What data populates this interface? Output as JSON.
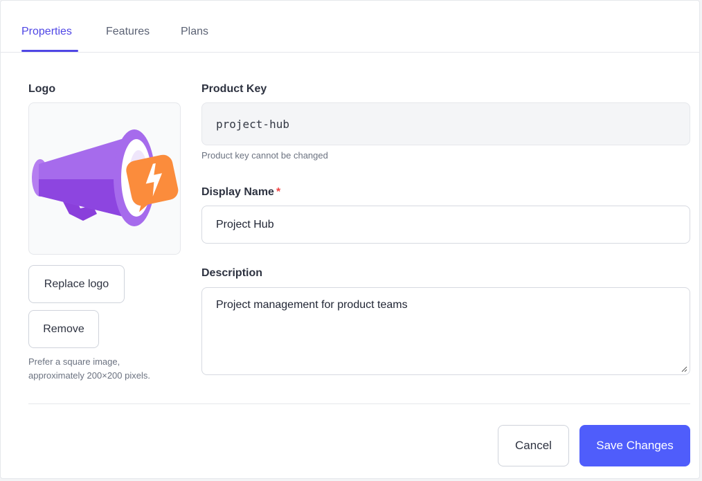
{
  "tabs": [
    {
      "label": "Properties",
      "active": true
    },
    {
      "label": "Features",
      "active": false
    },
    {
      "label": "Plans",
      "active": false
    }
  ],
  "logo": {
    "label": "Logo",
    "icon": "megaphone-lightning-icon",
    "replace_label": "Replace logo",
    "remove_label": "Remove",
    "hint_line1": "Prefer a square image,",
    "hint_line2": "approximately 200×200 pixels."
  },
  "product_key": {
    "label": "Product Key",
    "value": "project-hub",
    "hint": "Product key cannot be changed"
  },
  "display_name": {
    "label": "Display Name",
    "required_mark": "*",
    "value": "Project Hub"
  },
  "description": {
    "label": "Description",
    "value": "Project management for product teams"
  },
  "actions": {
    "cancel_label": "Cancel",
    "save_label": "Save Changes"
  },
  "colors": {
    "accent": "#4f46e5",
    "primary_button": "#4f5dfb",
    "required": "#ef4444",
    "megaphone_purple": "#9b59e8",
    "badge_orange": "#fb8c3c"
  }
}
